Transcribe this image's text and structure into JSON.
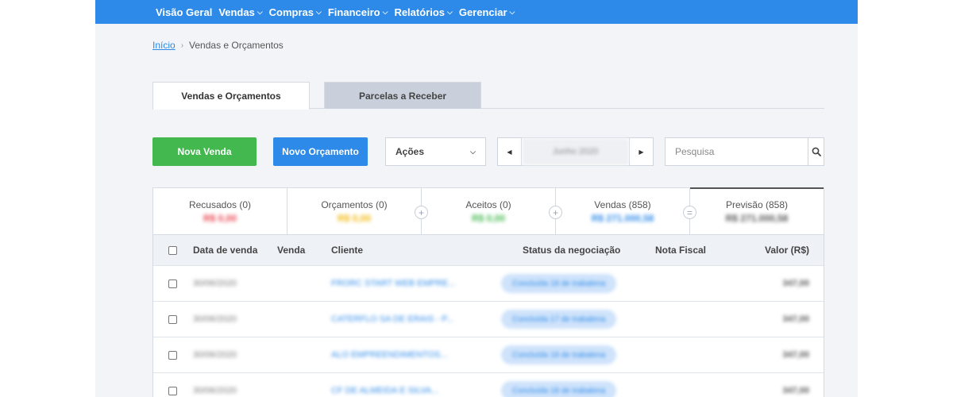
{
  "nav": {
    "items": [
      {
        "label": "Visão Geral",
        "has_dropdown": false
      },
      {
        "label": "Vendas",
        "has_dropdown": true
      },
      {
        "label": "Compras",
        "has_dropdown": true
      },
      {
        "label": "Financeiro",
        "has_dropdown": true
      },
      {
        "label": "Relatórios",
        "has_dropdown": true
      },
      {
        "label": "Gerenciar",
        "has_dropdown": true
      }
    ]
  },
  "breadcrumb": {
    "home": "Início",
    "current": "Vendas e Orçamentos"
  },
  "tabs": [
    {
      "label": "Vendas e Orçamentos",
      "active": true
    },
    {
      "label": "Parcelas a Receber",
      "active": false
    }
  ],
  "toolbar": {
    "new_sale": "Nova Venda",
    "new_quote": "Novo Orçamento",
    "actions": "Ações",
    "period": "Junho 2020",
    "search_placeholder": "Pesquisa"
  },
  "summary": [
    {
      "label": "Recusados (0)",
      "amount": "R$ 0,00",
      "color": "#e8434e",
      "operator": ""
    },
    {
      "label": "Orçamentos (0)",
      "amount": "R$ 0,00",
      "color": "#f2b705",
      "operator": "+"
    },
    {
      "label": "Aceitos (0)",
      "amount": "R$ 0,00",
      "color": "#43b84f",
      "operator": "+"
    },
    {
      "label": "Vendas (858)",
      "amount": "R$ 271.000,58",
      "color": "#2d8ae8",
      "operator": "="
    },
    {
      "label": "Previsão (858)",
      "amount": "R$ 271.000,58",
      "color": "#555555",
      "operator": ""
    }
  ],
  "table": {
    "columns": {
      "date": "Data de venda",
      "sale": "Venda",
      "client": "Cliente",
      "status": "Status da negociação",
      "invoice": "Nota Fiscal",
      "value": "Valor (R$)"
    },
    "rows": [
      {
        "date": "30/06/2020",
        "sale": "",
        "client": "FRORC START WEB EMPRE...",
        "status": "Concluída 18 de trabalena",
        "invoice": "",
        "value": "347,00"
      },
      {
        "date": "30/06/2020",
        "sale": "",
        "client": "CATERFLO SA DE ERAIS - P...",
        "status": "Concluída 17 de trabalena",
        "invoice": "",
        "value": "347,00"
      },
      {
        "date": "30/06/2020",
        "sale": "",
        "client": "ALO EMPREENDIMENTOS...",
        "status": "Concluída 18 de trabalena",
        "invoice": "",
        "value": "347,00"
      },
      {
        "date": "30/06/2020",
        "sale": "",
        "client": "CF DE ALMEIDA E SILVA...",
        "status": "Concluída 18 de trabalena",
        "invoice": "",
        "value": "347,00"
      }
    ]
  }
}
